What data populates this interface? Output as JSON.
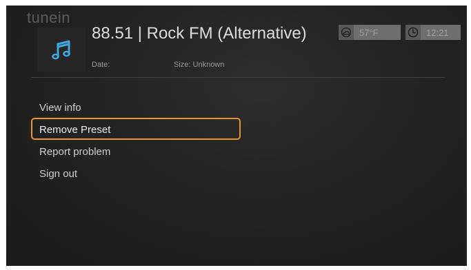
{
  "header": {
    "brand_ghost": "tunein",
    "title": "88.51 | Rock FM (Alternative)",
    "date_label": "Date:",
    "size_label": "Size: Unknown",
    "art_icon": "music-note-icon"
  },
  "status": {
    "weather_icon": "cloud-icon",
    "temperature": "57°F",
    "clock_icon": "clock-icon",
    "time": "12:21"
  },
  "menu": {
    "items": [
      {
        "label": "View info",
        "selected": false
      },
      {
        "label": "Remove Preset",
        "selected": true
      },
      {
        "label": "Report problem",
        "selected": false
      },
      {
        "label": "Sign out",
        "selected": false
      }
    ]
  },
  "colors": {
    "accent": "#e8952a",
    "icon_blue": "#3fa9e0"
  }
}
